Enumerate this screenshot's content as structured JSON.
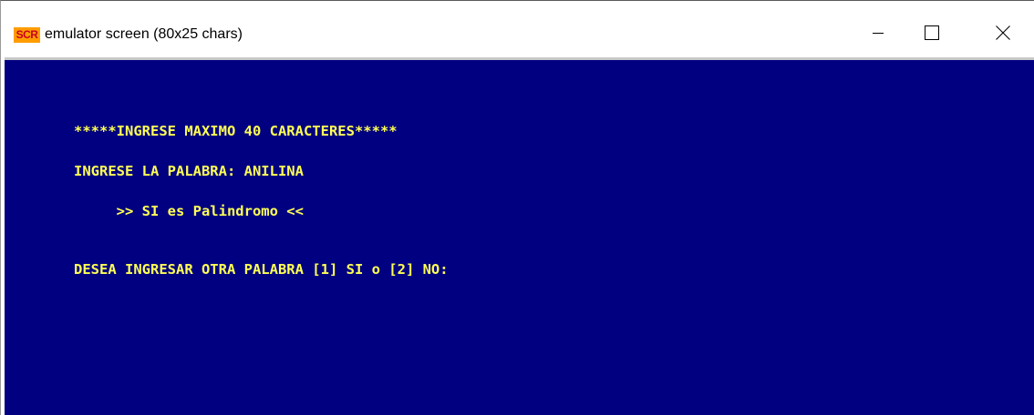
{
  "window": {
    "app_icon_text": "SCR",
    "title": "emulator screen (80x25 chars)",
    "controls": {
      "minimize": "minimize-icon",
      "maximize": "maximize-icon",
      "close": "close-icon"
    }
  },
  "colors": {
    "screen_background": "#000080",
    "screen_text": "#ffff55",
    "title_bar": "#ffffff"
  },
  "screen": {
    "lines": [
      "*****INGRESE MAXIMO 40 CARACTERES*****",
      "INGRESE LA PALABRA: ANILINA",
      "     >> SI es Palindromo <<",
      "DESEA INGRESAR OTRA PALABRA [1] SI o [2] NO:"
    ]
  }
}
